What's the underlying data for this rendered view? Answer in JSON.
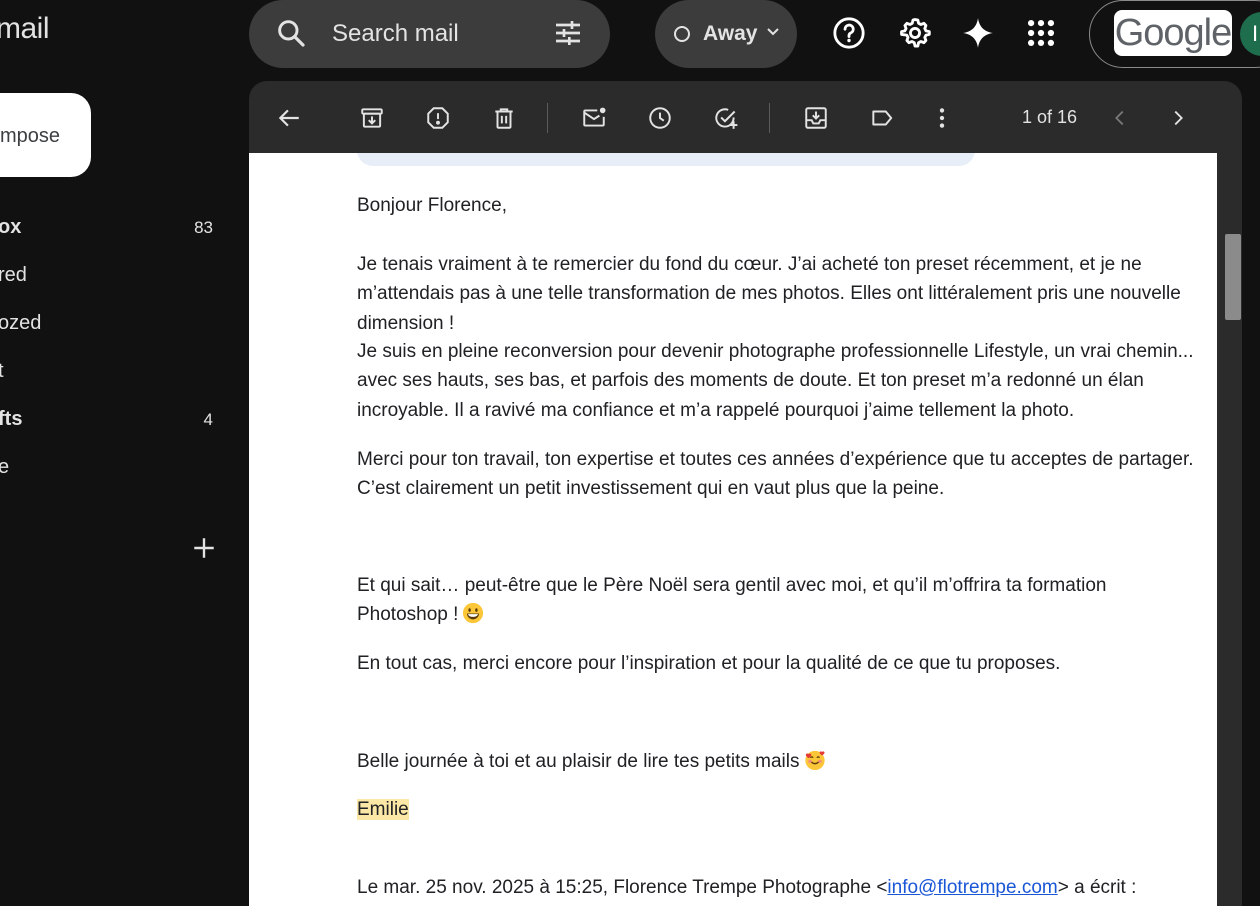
{
  "app": {
    "name": "mail"
  },
  "search": {
    "placeholder": "Search mail"
  },
  "status": {
    "label": "Away"
  },
  "brand": {
    "logo_text": "Google",
    "avatar_initial": "I"
  },
  "sidebar": {
    "compose_label": "mpose",
    "items": [
      {
        "label": "ox",
        "count": "83",
        "bold": true
      },
      {
        "label": "red",
        "count": ""
      },
      {
        "label": "ozed",
        "count": ""
      },
      {
        "label": "t",
        "count": ""
      },
      {
        "label": "fts",
        "count": "4",
        "bold": true
      },
      {
        "label": "e",
        "count": ""
      }
    ]
  },
  "toolbar": {
    "pager_text": "1 of 16"
  },
  "email": {
    "greeting": "Bonjour Florence,",
    "p1": "Je tenais vraiment à te remercier du fond du cœur. J’ai acheté ton preset récemment, et je ne m’attendais pas à une telle transformation de mes photos. Elles ont littéralement pris une nouvelle dimension !",
    "p2": "Je suis en pleine reconversion pour devenir photographe professionnelle Lifestyle, un vrai chemin... avec ses hauts, ses bas, et parfois des moments de doute. Et ton preset m’a redonné un élan incroyable. Il a ravivé ma confiance et m’a rappelé pourquoi j’aime tellement la photo.",
    "p3": "Merci pour ton travail, ton expertise et toutes ces années d’expérience que tu acceptes de partager. C’est clairement un petit investissement qui en vaut plus que la peine.",
    "p4": "Et qui sait… peut-être que le Père Noël sera gentil avec moi, et qu’il m’offrira ta formation Photoshop !",
    "p5": "En tout cas, merci encore pour l’inspiration et pour la qualité de ce que tu proposes.",
    "p6": "Belle journée à toi et au plaisir de lire tes petits mails",
    "signature": "Emilie",
    "quote_prefix": "Le mar. 25 nov. 2025 à 15:25, Florence Trempe Photographe <",
    "quote_email": "info@flotrempe.com",
    "quote_suffix": "> a écrit :"
  },
  "icons": {
    "top": [
      "search-icon",
      "tune-icon",
      "help-icon",
      "settings-icon",
      "gemini-sparkle-icon",
      "apps-grid-icon"
    ],
    "toolbar": [
      "back-arrow-icon",
      "archive-icon",
      "report-spam-icon",
      "delete-icon",
      "mark-unread-icon",
      "snooze-icon",
      "add-task-icon",
      "move-to-icon",
      "label-icon",
      "more-vert-icon",
      "chevron-left-icon",
      "chevron-right-icon"
    ],
    "emoji": [
      "grinning-face-icon",
      "smiling-face-hearts-icon"
    ]
  },
  "colors": {
    "background": "#111111",
    "panel": "#2b2b2b",
    "message_bg": "#ffffff",
    "link": "#1a57d6",
    "highlight": "#fce8a6"
  }
}
